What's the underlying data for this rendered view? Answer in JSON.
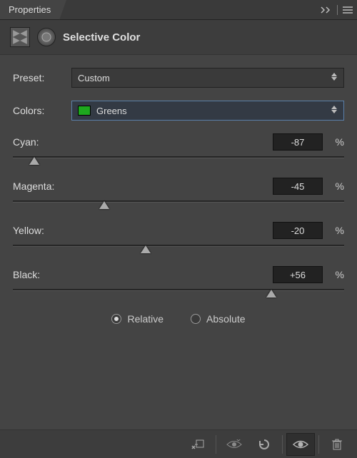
{
  "panel": {
    "title": "Properties"
  },
  "header": {
    "title": "Selective Color"
  },
  "preset": {
    "label": "Preset:",
    "value": "Custom"
  },
  "colors": {
    "label": "Colors:",
    "value": "Greens",
    "swatch": "#1ea81e"
  },
  "sliders": {
    "cyan": {
      "label": "Cyan:",
      "value": -87,
      "unit": "%"
    },
    "magenta": {
      "label": "Magenta:",
      "value": -45,
      "unit": "%"
    },
    "yellow": {
      "label": "Yellow:",
      "value": -20,
      "unit": "%"
    },
    "black": {
      "label": "Black:",
      "value": 56,
      "display": "+56",
      "unit": "%"
    }
  },
  "mode": {
    "relative": {
      "label": "Relative",
      "selected": true
    },
    "absolute": {
      "label": "Absolute",
      "selected": false
    }
  }
}
